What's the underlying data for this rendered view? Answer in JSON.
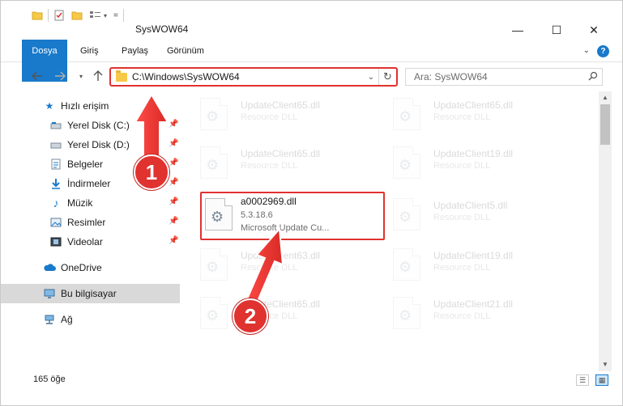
{
  "window": {
    "title": "SysWOW64",
    "controls": {
      "minimize": "—",
      "maximize": "☐",
      "close": "✕"
    }
  },
  "ribbon": {
    "tabs": [
      "Dosya",
      "Giriş",
      "Paylaş",
      "Görünüm"
    ],
    "help": "?"
  },
  "address_bar": {
    "path": "C:\\Windows\\SysWOW64",
    "search_placeholder": "Ara: SysWOW64"
  },
  "sidebar": {
    "items": [
      {
        "label": "Hızlı erişim",
        "icon": "star-icon",
        "pinned": false
      },
      {
        "label": "Yerel Disk (C:)",
        "icon": "drive-icon",
        "pinned": true
      },
      {
        "label": "Yerel Disk (D:)",
        "icon": "drive-icon",
        "pinned": true
      },
      {
        "label": "Belgeler",
        "icon": "documents-icon",
        "pinned": true
      },
      {
        "label": "İndirmeler",
        "icon": "download-icon",
        "pinned": true
      },
      {
        "label": "Müzik",
        "icon": "music-icon",
        "pinned": true
      },
      {
        "label": "Resimler",
        "icon": "pictures-icon",
        "pinned": true
      },
      {
        "label": "Videolar",
        "icon": "videos-icon",
        "pinned": true
      },
      {
        "label": "OneDrive",
        "icon": "cloud-icon",
        "pinned": false
      },
      {
        "label": "Bu bilgisayar",
        "icon": "computer-icon",
        "pinned": false
      },
      {
        "label": "Ağ",
        "icon": "network-icon",
        "pinned": false
      }
    ]
  },
  "files": {
    "left": [
      {
        "name": "UpdateClient65.dll",
        "type": "Resource DLL"
      },
      {
        "name": "UpdateClient65.dll",
        "type": "Resource DLL"
      },
      {
        "name": "a0002969.dll",
        "version": "5.3.18.6",
        "desc": "Microsoft Update Cu..."
      },
      {
        "name": "UpdateClient63.dll",
        "type": "Resource DLL"
      },
      {
        "name": "UpdateClient65.dll",
        "type": "Resource DLL"
      }
    ],
    "right": [
      {
        "name": "UpdateClient65.dll",
        "type": "Resource DLL"
      },
      {
        "name": "UpdateClient19.dll",
        "type": "Resource DLL"
      },
      {
        "name": "UpdateClient5.dll",
        "type": "Resource DLL"
      },
      {
        "name": "UpdateClient19.dll",
        "type": "Resource DLL"
      },
      {
        "name": "UpdateClient21.dll",
        "type": "Resource DLL"
      }
    ]
  },
  "status": {
    "count": "165 öğe"
  },
  "annotations": {
    "step1": "1",
    "step2": "2",
    "color": "#e0322f"
  }
}
